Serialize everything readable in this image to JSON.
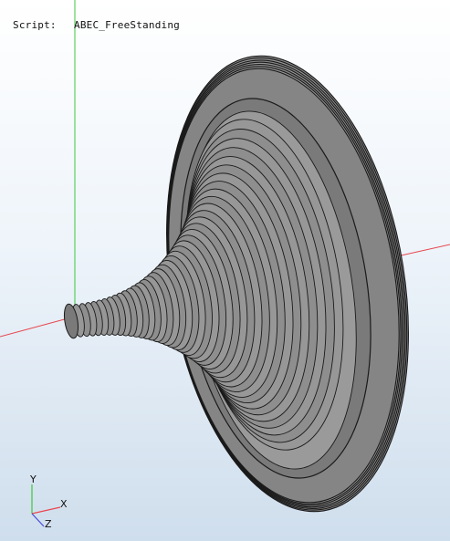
{
  "overlay": {
    "script_label": "Script:",
    "script_value": "ABEC_FreeStanding"
  },
  "axes": {
    "x_label": "X",
    "y_label": "Y",
    "z_label": "Z",
    "x_color": "#e8474f",
    "y_color": "#3cc83c",
    "z_color": "#4a4ad8"
  },
  "model": {
    "name": "horn-mesh",
    "fill_color": "#8c8c8c",
    "edge_color": "#1a1a1a"
  },
  "colors": {
    "background_top": "#ffffff",
    "background_bottom": "#cfdeed"
  }
}
